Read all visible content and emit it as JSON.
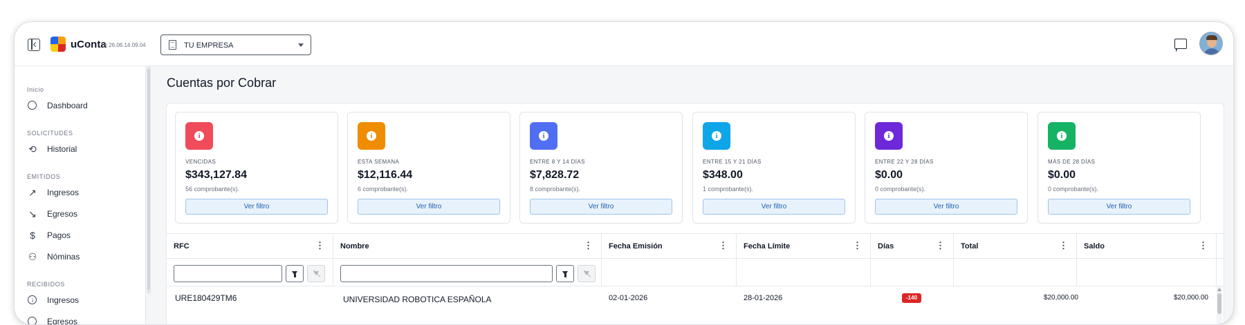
{
  "app": {
    "name": "uConta",
    "version": "v 26.06.14.09.04"
  },
  "header": {
    "company": "TU EMPRESA"
  },
  "sidebar": {
    "sections": [
      {
        "title": "Inicio",
        "items": [
          {
            "label": "Dashboard",
            "icon": "gauge-icon"
          }
        ]
      },
      {
        "title": "SOLICITUDES",
        "items": [
          {
            "label": "Historial",
            "icon": "history-icon"
          }
        ]
      },
      {
        "title": "EMITIDOS",
        "items": [
          {
            "label": "Ingresos",
            "icon": "trend-up-icon"
          },
          {
            "label": "Egresos",
            "icon": "trend-down-icon"
          },
          {
            "label": "Pagos",
            "icon": "dollar-icon"
          },
          {
            "label": "Nóminas",
            "icon": "users-icon"
          }
        ]
      },
      {
        "title": "RECIBIDOS",
        "items": [
          {
            "label": "Ingresos",
            "icon": "download-circle-icon"
          },
          {
            "label": "Egresos",
            "icon": "circle-icon"
          }
        ]
      }
    ]
  },
  "page": {
    "title": "Cuentas por Cobrar"
  },
  "cards": [
    {
      "caption": "VENCIDAS",
      "amount": "$343,127.84",
      "count": "56 comprobante(s).",
      "button": "Ver filtro",
      "color": "#ef4b5a"
    },
    {
      "caption": "ESTA SEMANA",
      "amount": "$12,116.44",
      "count": "6 comprobante(s).",
      "button": "Ver filtro",
      "color": "#f08c00"
    },
    {
      "caption": "ENTRE 8 Y 14 DÍAS",
      "amount": "$7,828.72",
      "count": "8 comprobante(s).",
      "button": "Ver filtro",
      "color": "#4f6ef2"
    },
    {
      "caption": "ENTRE 15 Y 21 DÍAS",
      "amount": "$348.00",
      "count": "1 comprobante(s).",
      "button": "Ver filtro",
      "color": "#0ea5e9"
    },
    {
      "caption": "ENTRE 22 Y 28 DÍAS",
      "amount": "$0.00",
      "count": "0 comprobante(s).",
      "button": "Ver filtro",
      "color": "#6d28d9"
    },
    {
      "caption": "MÁS DE 28 DÍAS",
      "amount": "$0.00",
      "count": "0 comprobante(s).",
      "button": "Ver filtro",
      "color": "#16b364"
    }
  ],
  "table": {
    "columns": [
      "RFC",
      "Nombre",
      "Fecha Emisión",
      "Fecha Límite",
      "Días",
      "Total",
      "Saldo"
    ],
    "rows": [
      {
        "rfc": "URE180429TM6",
        "nombre": "UNIVERSIDAD ROBOTICA ESPAÑOLA",
        "emision": "02-01-2026",
        "limite": "28-01-2026",
        "dias": "-140",
        "total": "$20,000.00",
        "saldo": "$20,000.00"
      }
    ]
  }
}
